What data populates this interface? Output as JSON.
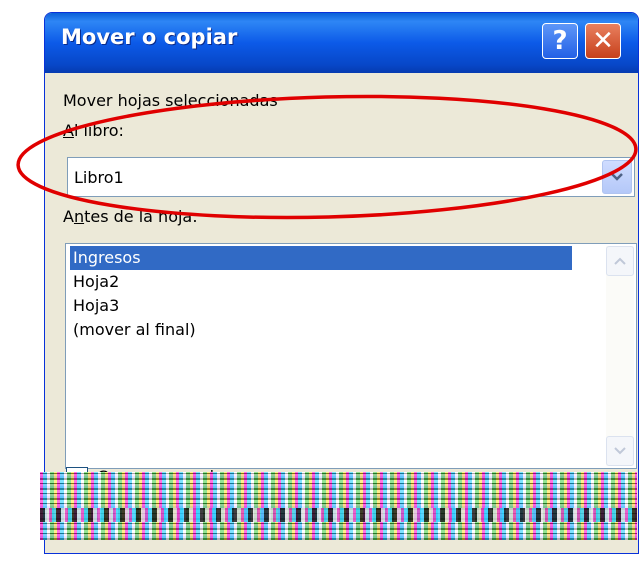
{
  "dialog": {
    "title": "Mover o copiar",
    "help_glyph": "?",
    "close_glyph": "✕",
    "label_move": "Mover hojas seleccionadas",
    "label_book_u": "A",
    "label_book_rest": "l libro:",
    "book_value": "Libro1",
    "label_before_pre": "A",
    "label_before_u": "n",
    "label_before_rest": "tes de la hoja:",
    "sheets": [
      "Ingresos",
      "Hoja2",
      "Hoja3",
      "(mover al final)"
    ],
    "selected_sheet_index": 0,
    "copy_label": "Crear una copia",
    "copy_checked": false
  },
  "icons": {
    "dropdown": "chevron-down-icon",
    "scroll_up": "scroll-up-icon",
    "scroll_down": "scroll-down-icon"
  },
  "colors": {
    "title_bar": "#0c5ae8",
    "selection": "#316ac5",
    "highlight_ellipse": "#e00000",
    "dialog_bg": "#ece9d8"
  }
}
